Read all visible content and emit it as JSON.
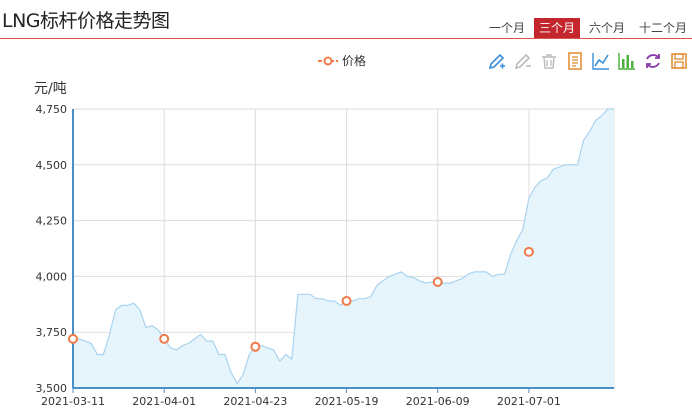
{
  "page": {
    "title": "LNG标杆价格走势图",
    "range_tabs": [
      {
        "label": "一个月",
        "active": false
      },
      {
        "label": "三个月",
        "active": true
      },
      {
        "label": "六个月",
        "active": false
      },
      {
        "label": "十二个月",
        "active": false
      }
    ],
    "toolbar_icons": [
      "mark-pen-icon",
      "erase-pen-icon",
      "clear-trash-icon",
      "data-view-icon",
      "line-chart-icon",
      "bar-chart-icon",
      "refresh-icon",
      "save-image-icon"
    ],
    "colors": {
      "accent": "#c4262e",
      "line": "#a9d3ee",
      "area": "#e6f5fc",
      "marker": "#f07a4a",
      "grid": "#dddddd",
      "axis": "#4a90c8",
      "toolbar_blue": "#3a8ed8",
      "toolbar_orange": "#e08a2c",
      "toolbar_green": "#4cae3c",
      "toolbar_purple": "#8a3aa8"
    }
  },
  "chart_data": {
    "type": "area",
    "ylabel": "元/吨",
    "ylim": [
      3500,
      4750
    ],
    "yticks": [
      3500,
      3750,
      4000,
      4250,
      4500,
      4750
    ],
    "ytick_labels": [
      "3,500",
      "3,750",
      "4,000",
      "4,250",
      "4,500",
      "4,750"
    ],
    "xticks": [
      "2021-03-11",
      "2021-04-01",
      "2021-04-23",
      "2021-05-19",
      "2021-06-09",
      "2021-07-01"
    ],
    "legend": {
      "position": "top-center"
    },
    "grid": true,
    "series": [
      {
        "name": "价格",
        "x": [
          "2021-03-11",
          "2021-03-12",
          "2021-03-15",
          "2021-03-16",
          "2021-03-17",
          "2021-03-18",
          "2021-03-19",
          "2021-03-22",
          "2021-03-23",
          "2021-03-24",
          "2021-03-25",
          "2021-03-26",
          "2021-03-29",
          "2021-03-30",
          "2021-03-31",
          "2021-04-01",
          "2021-04-02",
          "2021-04-06",
          "2021-04-07",
          "2021-04-08",
          "2021-04-09",
          "2021-04-12",
          "2021-04-13",
          "2021-04-14",
          "2021-04-15",
          "2021-04-16",
          "2021-04-19",
          "2021-04-20",
          "2021-04-21",
          "2021-04-22",
          "2021-04-23",
          "2021-04-26",
          "2021-04-27",
          "2021-04-28",
          "2021-04-29",
          "2021-04-30",
          "2021-05-06",
          "2021-05-07",
          "2021-05-10",
          "2021-05-11",
          "2021-05-12",
          "2021-05-13",
          "2021-05-14",
          "2021-05-17",
          "2021-05-18",
          "2021-05-19",
          "2021-05-20",
          "2021-05-21",
          "2021-05-24",
          "2021-05-25",
          "2021-05-26",
          "2021-05-27",
          "2021-05-28",
          "2021-05-31",
          "2021-06-01",
          "2021-06-02",
          "2021-06-03",
          "2021-06-04",
          "2021-06-07",
          "2021-06-08",
          "2021-06-09",
          "2021-06-10",
          "2021-06-11",
          "2021-06-15",
          "2021-06-16",
          "2021-06-17",
          "2021-06-18",
          "2021-06-21",
          "2021-06-22",
          "2021-06-23",
          "2021-06-24",
          "2021-06-25",
          "2021-06-28",
          "2021-06-29",
          "2021-06-30",
          "2021-07-01",
          "2021-07-02",
          "2021-07-05",
          "2021-07-06",
          "2021-07-07",
          "2021-07-08",
          "2021-07-09",
          "2021-07-12",
          "2021-07-13",
          "2021-07-14",
          "2021-07-15",
          "2021-07-16",
          "2021-07-19",
          "2021-07-20",
          "2021-07-21"
        ],
        "values": [
          3720,
          3720,
          3710,
          3700,
          3650,
          3650,
          3740,
          3850,
          3870,
          3870,
          3880,
          3850,
          3770,
          3780,
          3760,
          3720,
          3680,
          3670,
          3690,
          3700,
          3720,
          3740,
          3710,
          3710,
          3650,
          3650,
          3570,
          3520,
          3560,
          3650,
          3685,
          3690,
          3680,
          3670,
          3620,
          3650,
          3630,
          3920,
          3920,
          3920,
          3900,
          3900,
          3890,
          3890,
          3870,
          3890,
          3890,
          3900,
          3900,
          3910,
          3960,
          3980,
          4000,
          4010,
          4020,
          4000,
          3995,
          3980,
          3970,
          3975,
          3975,
          3970,
          3970,
          3980,
          3990,
          4010,
          4020,
          4020,
          4020,
          4000,
          4010,
          4010,
          4100,
          4160,
          4210,
          4350,
          4400,
          4430,
          4440,
          4480,
          4490,
          4500,
          4500,
          4500,
          4610,
          4650,
          4700,
          4720,
          4750,
          4750
        ]
      }
    ],
    "markers": [
      {
        "x": "2021-03-11",
        "value": 3720
      },
      {
        "x": "2021-04-01",
        "value": 3720
      },
      {
        "x": "2021-04-23",
        "value": 3685
      },
      {
        "x": "2021-05-19",
        "value": 3890
      },
      {
        "x": "2021-06-09",
        "value": 3975
      },
      {
        "x": "2021-07-01",
        "value": 4110
      }
    ]
  }
}
